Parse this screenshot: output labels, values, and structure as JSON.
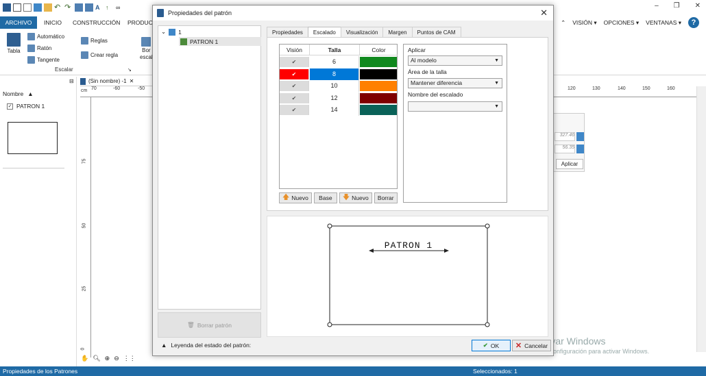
{
  "ribbon": {
    "tabs": [
      "ARCHIVO",
      "INICIO",
      "CONSTRUCCIÓN",
      "PRODUC"
    ],
    "menus_right": [
      "VISIÓN ▾",
      "OPCIONES ▾",
      "VENTANAS ▾"
    ],
    "items": {
      "tabla": "Tabla",
      "automatico": "Automático",
      "raton": "Ratón",
      "tangente": "Tangente",
      "reglas": "Reglas",
      "crear_regla": "Crear regla",
      "bor": "Bor",
      "escal": "escal"
    },
    "group_label": "Escalar"
  },
  "left_panel": {
    "header": "Nombre",
    "item": "PATRON 1"
  },
  "document_tab": "(Sin nombre) -1",
  "ruler": {
    "unit": "cm",
    "top_left_labels": [
      "70",
      "-60",
      "-50"
    ],
    "top_right_labels": [
      "120",
      "130",
      "140",
      "150",
      "160"
    ],
    "left_labels": [
      "75",
      "50",
      "25",
      "0"
    ]
  },
  "float_panel": {
    "field1": "327.46",
    "field2": "56.35",
    "apply": "Aplicar"
  },
  "watermark": {
    "line1": "Activar Windows",
    "line2": "Ve a Configuración para activar Windows."
  },
  "status": {
    "left": "Propiedades de los Patrones",
    "right": "Seleccionados: 1"
  },
  "dialog": {
    "title": "Propiedades del patrón",
    "tree_root": "1",
    "tree_child": "PATRON 1",
    "delete_button": "Borrar patrón",
    "legend_toggle": "Leyenda del estado del patrón:",
    "tabs": [
      "Propiedades",
      "Escalado",
      "Visualización",
      "Margen",
      "Puntos de CAM"
    ],
    "active_tab": "Escalado",
    "table_headers": [
      "Visión",
      "Talla",
      "Color"
    ],
    "sizes": [
      {
        "vis": "✔",
        "size": "6",
        "color": "#10891e",
        "selected": false
      },
      {
        "vis": "✔",
        "size": "8",
        "color": "#000000",
        "selected": true
      },
      {
        "vis": "✔",
        "size": "10",
        "color": "#ff8000",
        "selected": false
      },
      {
        "vis": "✔",
        "size": "12",
        "color": "#7f0000",
        "selected": false
      },
      {
        "vis": "✔",
        "size": "14",
        "color": "#0a6258",
        "selected": false
      }
    ],
    "table_buttons": [
      "Nuevo",
      "Base",
      "Nuevo",
      "Borrar"
    ],
    "apply_label": "Aplicar",
    "apply_value": "Al modelo",
    "size_area_label": "Área de la talla",
    "size_area_value": "Mantener diferencia",
    "grading_name_label": "Nombre del escalado",
    "grading_name_value": "",
    "preview_label": "PATRON 1",
    "ok": "OK",
    "cancel": "Cancelar"
  }
}
